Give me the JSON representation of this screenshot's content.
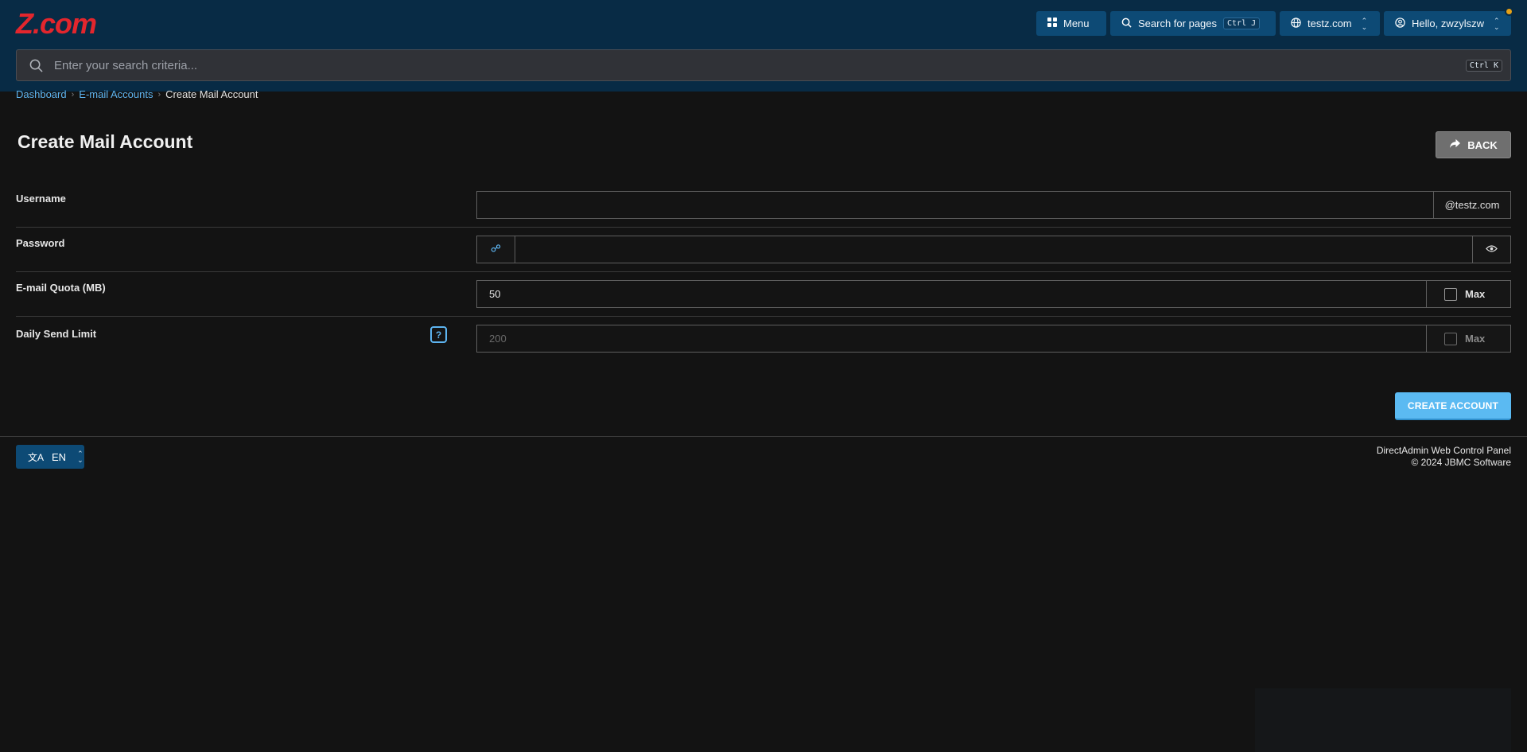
{
  "header": {
    "logo_text": "Z.com",
    "menu_label": "Menu",
    "search_pages_label": "Search for pages",
    "search_pages_shortcut": "Ctrl J",
    "domain_label": "testz.com",
    "user_label": "Hello, zwzylszw"
  },
  "search": {
    "placeholder": "Enter your search criteria...",
    "shortcut": "Ctrl K"
  },
  "breadcrumb": {
    "items": [
      "Dashboard",
      "E-mail Accounts",
      "Create Mail Account"
    ]
  },
  "page": {
    "title": "Create Mail Account",
    "back_label": "BACK"
  },
  "form": {
    "username": {
      "label": "Username",
      "value": "",
      "suffix": "@testz.com"
    },
    "password": {
      "label": "Password",
      "value": ""
    },
    "quota": {
      "label": "E-mail Quota (MB)",
      "value": "50",
      "max_label": "Max",
      "max_checked": false
    },
    "send_limit": {
      "label": "Daily Send Limit",
      "placeholder": "200",
      "max_label": "Max",
      "max_checked": false,
      "help_text": "?"
    },
    "submit_label": "CREATE ACCOUNT"
  },
  "footer": {
    "language": "EN",
    "line1": "DirectAdmin Web Control Panel",
    "line2": "© 2024 JBMC Software"
  },
  "colors": {
    "header_bg": "#082b45",
    "accent": "#5db4f0",
    "logo": "#e3262d",
    "page_bg": "#131313"
  }
}
